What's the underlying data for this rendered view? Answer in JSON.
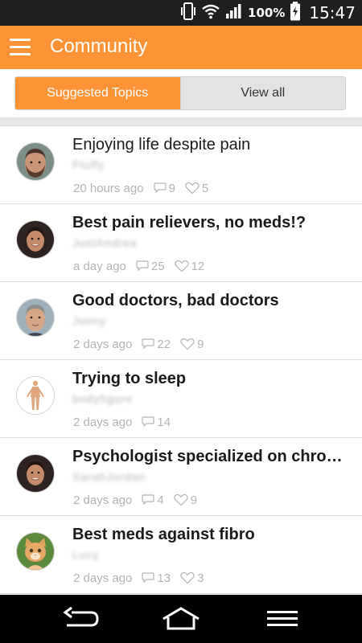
{
  "status_bar": {
    "battery_percent": "100%",
    "time": "15:47",
    "icons": [
      "vibrate-icon",
      "wifi-icon",
      "signal-icon",
      "battery-charging-icon"
    ]
  },
  "app_bar": {
    "title": "Community",
    "menu_icon": "hamburger-menu-icon"
  },
  "tabs": {
    "suggested": "Suggested Topics",
    "view_all": "View all",
    "selected": "suggested"
  },
  "topics": [
    {
      "title": "Enjoying life despite pain",
      "author": "Fluffy",
      "time": "20 hours ago",
      "comments": "9",
      "likes": "5",
      "avatar": "bearded-man"
    },
    {
      "title": "Best pain relievers, no meds!?",
      "author": "JustAndrea",
      "time": "a day ago",
      "comments": "25",
      "likes": "12",
      "avatar": "smiling-woman"
    },
    {
      "title": "Good doctors, bad doctors",
      "author": "Jonny",
      "time": "2 days ago",
      "comments": "22",
      "likes": "9",
      "avatar": "man-grey-hair"
    },
    {
      "title": "Trying to sleep",
      "author": "bodyfigure",
      "time": "2 days ago",
      "comments": "14",
      "likes": "",
      "avatar": "body-figure"
    },
    {
      "title": "Psychologist specialized on chronic …",
      "author": "SarahJordan",
      "time": "2 days ago",
      "comments": "4",
      "likes": "9",
      "avatar": "smiling-woman"
    },
    {
      "title": "Best meds against fibro",
      "author": "Lucy",
      "time": "2 days ago",
      "comments": "13",
      "likes": "3",
      "avatar": "kitten"
    }
  ],
  "nav_bar": {
    "icons": [
      "back-icon",
      "home-icon",
      "menu-icon"
    ]
  },
  "colors": {
    "accent": "#fd9335",
    "status_bar": "#1f1f1f",
    "meta_text": "#b3b3b3"
  }
}
